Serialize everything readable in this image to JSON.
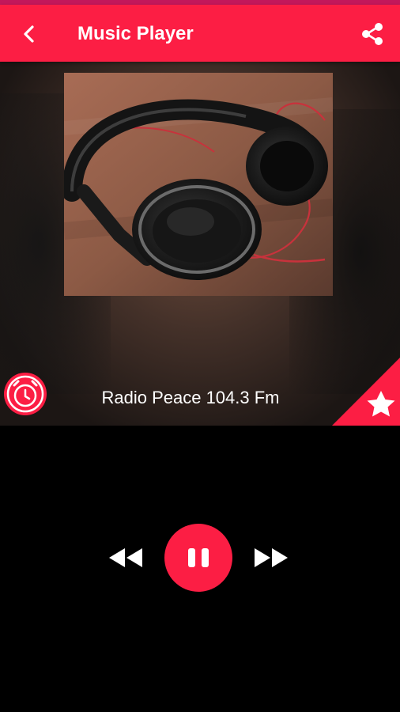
{
  "header": {
    "title": "Music Player",
    "back_icon": "arrow-back-icon",
    "share_icon": "share-icon",
    "color": "#fc1e44"
  },
  "now_playing": {
    "station": "Radio Peace 104.3 Fm",
    "artwork": "headphones-photo"
  },
  "actions": {
    "alarm_icon": "alarm-clock-icon",
    "favorite_icon": "star-icon"
  },
  "controls": {
    "previous_icon": "rewind-icon",
    "play_state": "playing",
    "pause_icon": "pause-icon",
    "next_icon": "fast-forward-icon",
    "accent": "#fc1e44"
  }
}
